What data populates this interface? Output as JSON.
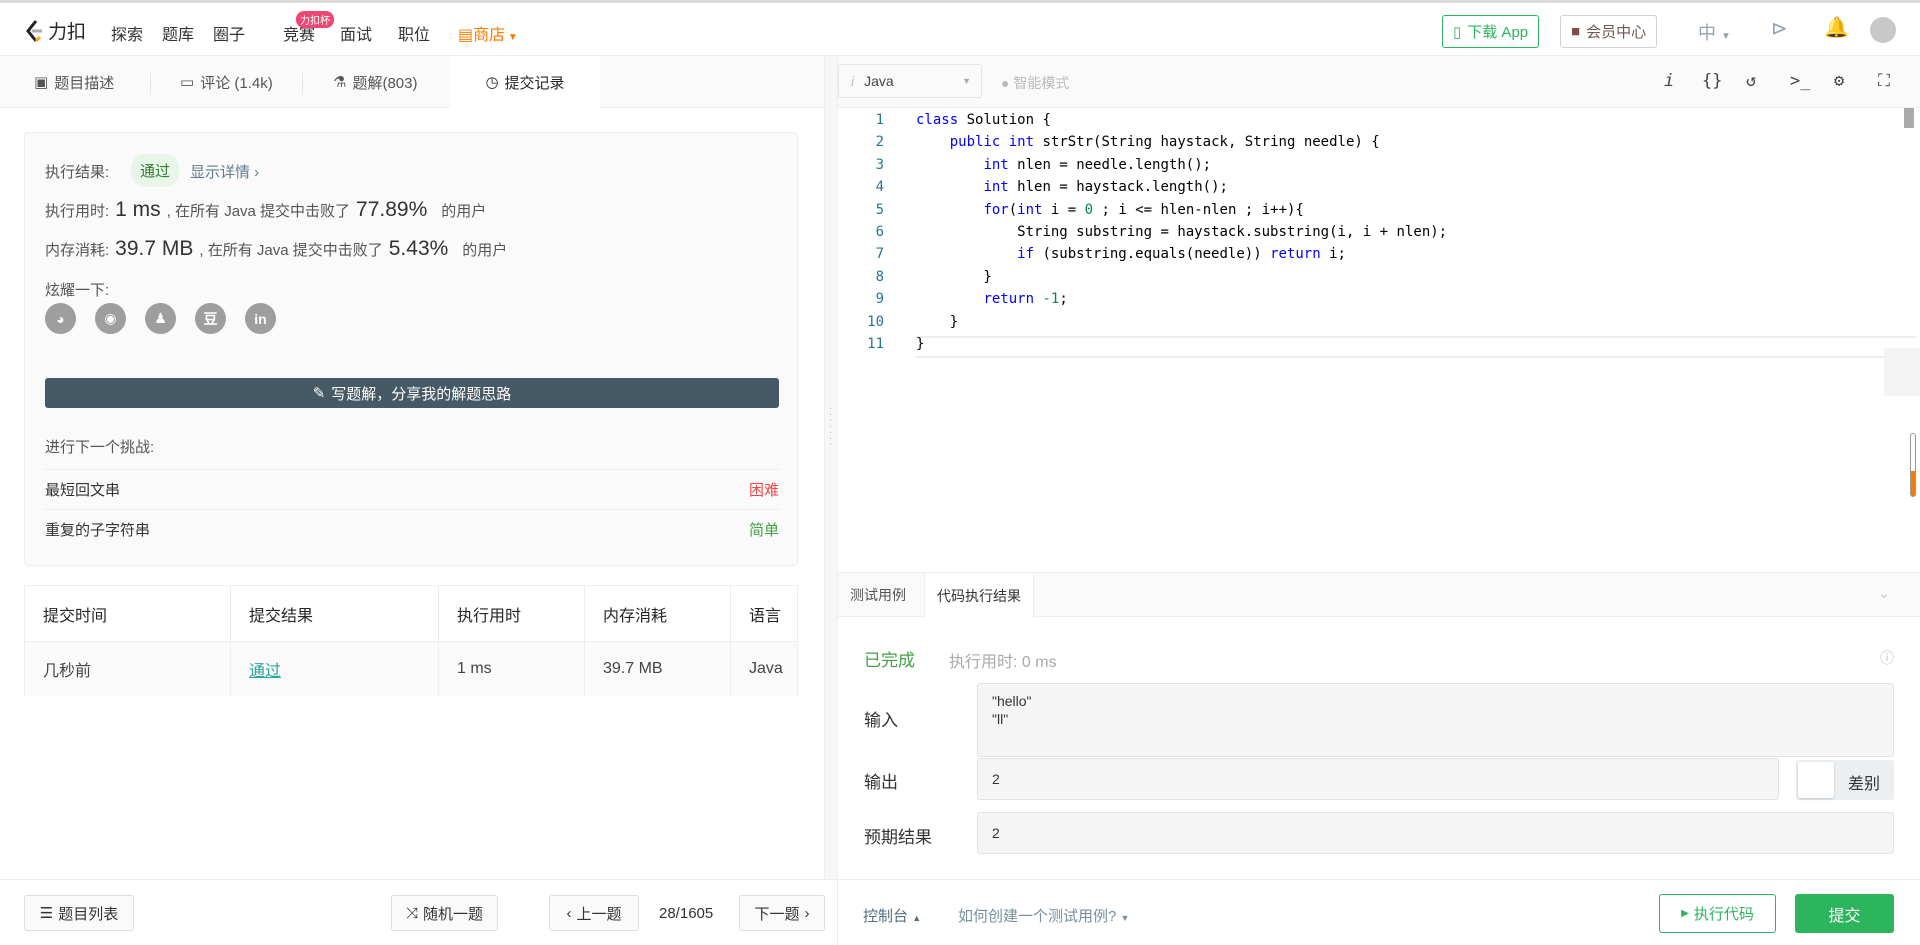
{
  "nav": {
    "logo_text": "力扣",
    "items": [
      "探索",
      "题库",
      "圈子",
      "竞赛",
      "面试",
      "职位"
    ],
    "contest_badge": "力扣杯",
    "store": "商店",
    "download": "下载 App",
    "vip": "会员中心",
    "lang": "中",
    "colors": {
      "brand": "#ffa116",
      "store": "#ff7a00",
      "green": "#2db55d"
    }
  },
  "tabs": [
    {
      "label": "题目描述",
      "icon": "description-icon"
    },
    {
      "label": "评论 (1.4k)",
      "icon": "comment-icon"
    },
    {
      "label": "题解(803)",
      "icon": "flask-icon"
    },
    {
      "label": "提交记录",
      "icon": "clock-icon",
      "active": true
    }
  ],
  "result": {
    "label": "执行结果:",
    "status": "通过",
    "detail": "显示详情 ›",
    "time_label": "执行用时:",
    "time_value": "1 ms",
    "time_mid": ", 在所有 Java 提交中击败了",
    "time_pct": "77.89%",
    "suffix": "的用户",
    "mem_label": "内存消耗:",
    "mem_value": "39.7 MB",
    "mem_mid": ", 在所有 Java 提交中击败了",
    "mem_pct": "5.43%",
    "share_label": "炫耀一下:",
    "write_btn": "写题解，分享我的解题思路",
    "next_label": "进行下一个挑战:",
    "next": [
      {
        "title": "最短回文串",
        "difficulty": "困难",
        "color": "#ec4c47"
      },
      {
        "title": "重复的子字符串",
        "difficulty": "简单",
        "color": "#43a047"
      }
    ]
  },
  "social": [
    "wechat-icon",
    "weibo-icon",
    "qq-icon",
    "douban-icon",
    "linkedin-icon"
  ],
  "social_glyphs": [
    "◕",
    "◉",
    "♟",
    "豆",
    "in"
  ],
  "table": {
    "headers": [
      "提交时间",
      "提交结果",
      "执行用时",
      "内存消耗",
      "语言"
    ],
    "rows": [
      [
        "几秒前",
        "通过",
        "1 ms",
        "39.7 MB",
        "Java"
      ]
    ]
  },
  "editor": {
    "language": "Java",
    "mode": "智能模式",
    "lines": [
      "class Solution {",
      "    public int strStr(String haystack, String needle) {",
      "        int nlen = needle.length();",
      "        int hlen = haystack.length();",
      "        for(int i = 0 ; i <= hlen-nlen ; i++){",
      "            String substring = haystack.substring(i, i + nlen);",
      "            if (substring.equals(needle)) return i;",
      "        }",
      "        return -1;",
      "    }",
      "}"
    ]
  },
  "console": {
    "tabs": [
      "测试用例",
      "代码执行结果"
    ],
    "status": "已完成",
    "time": "执行用时: 0 ms",
    "input_label": "输入",
    "input": [
      "\"hello\"",
      "\"ll\""
    ],
    "output_label": "输出",
    "output": "2",
    "diff": "差别",
    "expected_label": "预期结果",
    "expected": "2"
  },
  "bottom": {
    "list": "题目列表",
    "random": "随机一题",
    "prev": "上一题",
    "page": "28/1605",
    "next": "下一题",
    "console": "控制台",
    "howto": "如何创建一个测试用例?",
    "run": "执行代码",
    "submit": "提交"
  }
}
